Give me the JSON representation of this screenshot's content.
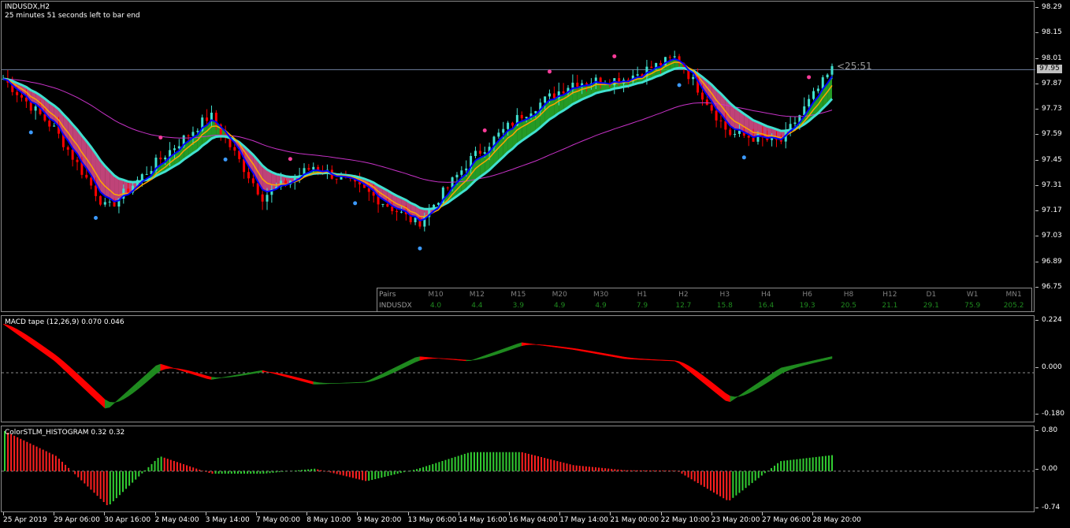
{
  "main": {
    "symbol_title": "INDUSDX,H2",
    "bar_timer_text": "25 minutes 51 seconds left to bar end",
    "countdown": "<25:51",
    "current_price": "97.95",
    "price_labels": [
      "98.29",
      "98.15",
      "98.01",
      "97.87",
      "97.73",
      "97.59",
      "97.45",
      "97.31",
      "97.17",
      "97.03",
      "96.89",
      "96.75"
    ]
  },
  "table": {
    "header_label": "Pairs",
    "row_label": "INDUSDX",
    "timeframes": [
      "M10",
      "M12",
      "M15",
      "M20",
      "M30",
      "H1",
      "H2",
      "H3",
      "H4",
      "H6",
      "H8",
      "H12",
      "D1",
      "W1",
      "MN1"
    ],
    "values": [
      "4.0",
      "4.4",
      "3.9",
      "4.9",
      "4.9",
      "7.9",
      "12.7",
      "15.8",
      "16.4",
      "19.3",
      "20.5",
      "21.1",
      "29.1",
      "75.9",
      "205.2"
    ]
  },
  "macd": {
    "title": "MACD tape (12,26,9) 0.070 0.046",
    "levels": [
      "0.224",
      "0.000",
      "-0.180"
    ]
  },
  "hist": {
    "title": "ColorSTLM_HISTOGRAM 0.32 0.32",
    "levels": [
      "0.80",
      "0.00",
      "-0.74"
    ]
  },
  "xaxis": {
    "labels": [
      "25 Apr 2019",
      "29 Apr 06:00",
      "30 Apr 16:00",
      "2 May 04:00",
      "3 May 14:00",
      "7 May 00:00",
      "8 May 10:00",
      "9 May 20:00",
      "13 May 06:00",
      "14 May 16:00",
      "16 May 04:00",
      "17 May 14:00",
      "21 May 00:00",
      "22 May 10:00",
      "23 May 20:00",
      "27 May 06:00",
      "28 May 20:00"
    ]
  },
  "colors": {
    "bull_candle": "#40e0d0",
    "bear_candle": "#ff0000",
    "ribbon_bull": "#32cd32",
    "ribbon_bear": "#ff5aa0",
    "ma_fast": "#0000ff",
    "ma_orange": "#ffa500",
    "ma_teal": "#40e0d0",
    "ma_slow": "#c832c8",
    "hist_up": "#32cd32",
    "hist_down": "#ff2020"
  },
  "chart_data": [
    {
      "type": "candlestick",
      "title": "INDUSDX,H2",
      "ylim": [
        96.75,
        98.29
      ],
      "x": [
        "25 Apr 2019",
        "29 Apr 06:00",
        "30 Apr 16:00",
        "2 May 04:00",
        "3 May 14:00",
        "7 May 00:00",
        "8 May 10:00",
        "9 May 20:00",
        "13 May 06:00",
        "14 May 16:00",
        "16 May 04:00",
        "17 May 14:00",
        "21 May 00:00",
        "22 May 10:00",
        "23 May 20:00",
        "27 May 06:00",
        "28 May 20:00"
      ],
      "close": [
        97.9,
        97.62,
        97.18,
        97.45,
        97.7,
        97.25,
        97.42,
        97.28,
        97.1,
        97.45,
        97.7,
        97.88,
        97.9,
        98.02,
        97.6,
        97.55,
        97.95
      ],
      "last": 97.95
    },
    {
      "type": "area",
      "title": "MACD tape (12,26,9) 0.070 0.046",
      "ylim": [
        -0.18,
        0.224
      ],
      "values": [
        0.21,
        0.05,
        -0.16,
        0.04,
        -0.03,
        0.01,
        -0.05,
        -0.04,
        0.07,
        0.05,
        0.13,
        0.1,
        0.06,
        0.05,
        -0.13,
        0.02,
        0.07
      ]
    },
    {
      "type": "bar",
      "title": "ColorSTLM_HISTOGRAM 0.32 0.32",
      "ylim": [
        -0.74,
        0.8
      ],
      "values": [
        0.8,
        0.3,
        -0.7,
        0.3,
        -0.05,
        -0.05,
        0.05,
        -0.2,
        0.05,
        0.38,
        0.38,
        0.12,
        0.02,
        0.01,
        -0.6,
        0.2,
        0.32
      ]
    }
  ]
}
